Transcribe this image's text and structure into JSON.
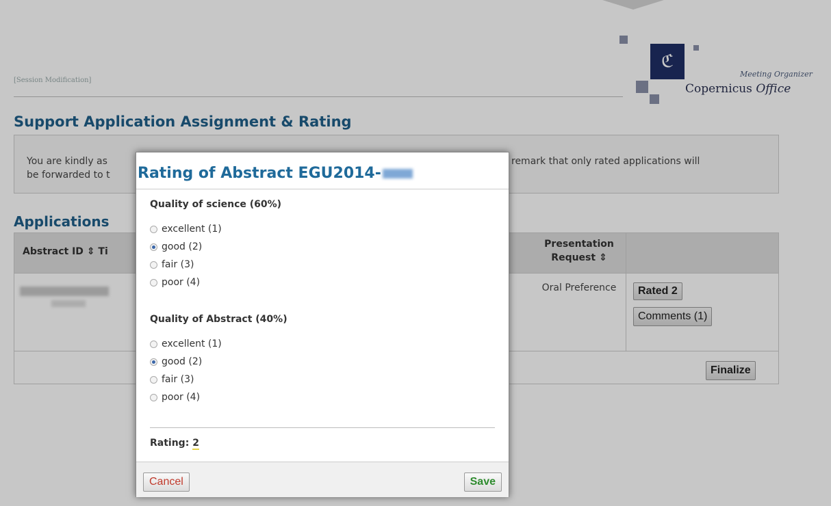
{
  "header": {
    "session_link": "[Session Modification]",
    "logo_org_text": "Meeting Organizer",
    "logo_office_text": "Copernicus",
    "logo_office_suffix": "Office",
    "logo_emblem": "ℭ"
  },
  "main": {
    "title": "Support Application Assignment & Rating",
    "notice_line1_start": "You are kindly as",
    "notice_line1_end": "remark that only rated applications will",
    "notice_line2_start": "be forwarded to t"
  },
  "applications": {
    "title": "Applications",
    "columns": {
      "abstract_id": "Abstract ID ⇕",
      "title_partial": "Ti",
      "presentation_request": "Presentation Request ⇕"
    },
    "row": {
      "presentation": "Oral Preference",
      "rated_label": "Rated 2",
      "comments_label": "Comments (1)"
    },
    "finalize_label": "Finalize"
  },
  "modal": {
    "title": "Rating of Abstract EGU2014-",
    "science": {
      "heading": "Quality of science (60%)",
      "options": [
        "excellent (1)",
        "good (2)",
        "fair (3)",
        "poor (4)"
      ],
      "selected": 1
    },
    "abstract": {
      "heading": "Quality of Abstract (40%)",
      "options": [
        "excellent (1)",
        "good (2)",
        "fair (3)",
        "poor (4)"
      ],
      "selected": 1
    },
    "rating_label": "Rating:",
    "rating_value": "2",
    "cancel_label": "Cancel",
    "save_label": "Save"
  }
}
